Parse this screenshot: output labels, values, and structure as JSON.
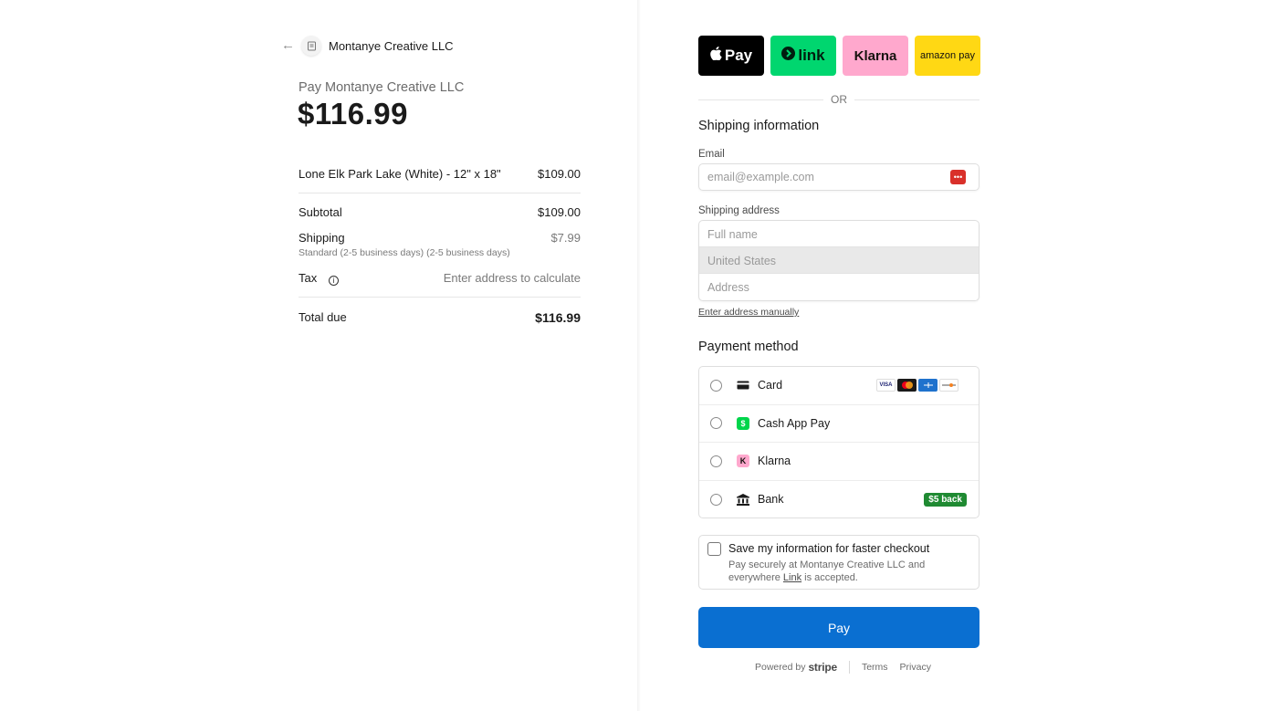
{
  "merchant": {
    "name": "Montanye Creative LLC",
    "pay_label": "Pay Montanye Creative LLC",
    "total": "$116.99"
  },
  "summary": {
    "item_name": "Lone Elk Park Lake (White) - 12\" x 18\"",
    "item_price": "$109.00",
    "subtotal_label": "Subtotal",
    "subtotal_value": "$109.00",
    "shipping_label": "Shipping",
    "shipping_desc": "Standard (2-5 business days) (2-5 business days)",
    "shipping_value": "$7.99",
    "tax_label": "Tax",
    "tax_value": "Enter address to calculate",
    "total_label": "Total due",
    "total_value": "$116.99"
  },
  "express": {
    "apple": "Pay",
    "link": "link",
    "klarna": "Klarna",
    "amazon": "amazon pay",
    "or": "OR"
  },
  "shipping_form": {
    "title": "Shipping information",
    "email_label": "Email",
    "email_placeholder": "email@example.com",
    "address_label": "Shipping address",
    "fullname_placeholder": "Full name",
    "country": "United States",
    "address_placeholder": "Address",
    "manual_link": "Enter address manually"
  },
  "payment": {
    "title": "Payment method",
    "methods": [
      {
        "label": "Card",
        "icon": "card-icon"
      },
      {
        "label": "Cash App Pay",
        "icon": "cashapp-icon"
      },
      {
        "label": "Klarna",
        "icon": "klarna-icon"
      },
      {
        "label": "Bank",
        "icon": "bank-icon"
      }
    ],
    "card_brands": [
      "VISA",
      "MC",
      "AMEX",
      "DISCOVER"
    ],
    "bank_badge": "$5 back"
  },
  "save_info": {
    "title": "Save my information for faster checkout",
    "desc_before": "Pay securely at Montanye Creative LLC and everywhere ",
    "desc_link": "Link",
    "desc_after": " is accepted."
  },
  "pay_button": "Pay",
  "footer": {
    "powered_by": "Powered by",
    "stripe": "stripe",
    "terms": "Terms",
    "privacy": "Privacy"
  },
  "colors": {
    "pay_button": "#0a6fd1",
    "link_green": "#00d66f",
    "klarna_pink": "#ffa8cd",
    "amazon_yellow": "#ffd814",
    "badge_green": "#1f8a32"
  }
}
